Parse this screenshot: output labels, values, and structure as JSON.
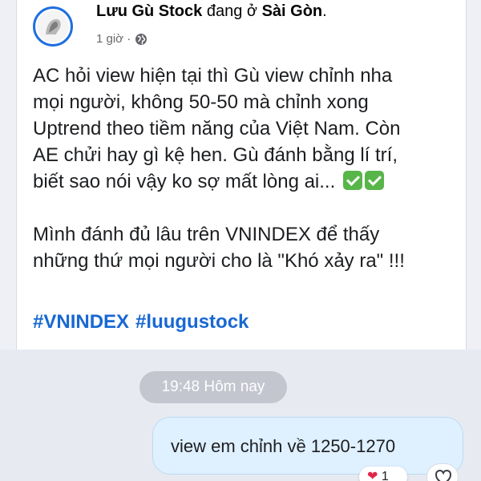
{
  "post": {
    "author": "Lưu Gù Stock",
    "location_prefix": "đang ở",
    "location": "Sài Gòn",
    "location_suffix": ".",
    "time": "1 giờ ·",
    "audience_icon": "globe-icon",
    "paragraph_1": "AC hỏi view hiện tại thì Gù view chỉnh nha\nmọi người, không 50-50 mà chỉnh xong\nUptrend theo tiềm năng của Việt Nam. Còn\nAE chửi hay gì kệ hen. Gù đánh bằng lí trí,\nbiết sao nói vậy ko sợ mất lòng ai...",
    "paragraph_2": "Mình đánh đủ lâu trên VNINDEX để thấy\nnhững thứ mọi người cho là \"Khó xảy ra\" !!!",
    "hashtags": [
      "#VNINDEX",
      "#luugustock"
    ]
  },
  "chat": {
    "timestamp": "19:48 Hôm nay",
    "message": "view em chỉnh về 1250-1270",
    "reaction_count": "1"
  },
  "colors": {
    "link": "#1868d3",
    "bubble": "#dff0ff",
    "background": "#e8eaf2"
  }
}
